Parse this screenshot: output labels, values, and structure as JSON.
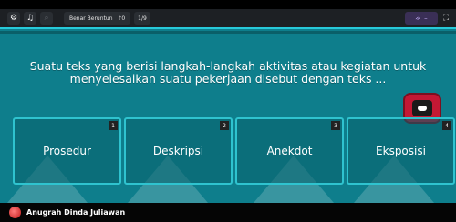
{
  "topbar": {
    "settings_icon": "gear-icon",
    "music_icon": "music-note-icon",
    "zoom_icon": "search-icon",
    "mode_label": "Benar Beruntun",
    "mode_value": "0",
    "page_label": "1/9",
    "user_badge_icon": "owl-icon",
    "user_badge_text": "–",
    "fullscreen_icon": "fullscreen-icon"
  },
  "question": {
    "text": "Suatu teks yang berisi langkah-langkah aktivitas atau kegiatan untuk menyelesaikan suatu pekerjaan disebut dengan teks ..."
  },
  "answers": [
    {
      "number": "1",
      "label": "Prosedur"
    },
    {
      "number": "2",
      "label": "Deskripsi"
    },
    {
      "number": "3",
      "label": "Anekdot"
    },
    {
      "number": "4",
      "label": "Eksposisi"
    }
  ],
  "player": {
    "name": "Anugrah Dinda Juliawan"
  },
  "colors": {
    "stage_bg": "#0e7e8c",
    "answer_border": "#2fc3cf",
    "topbar_bg": "#1d2024"
  }
}
